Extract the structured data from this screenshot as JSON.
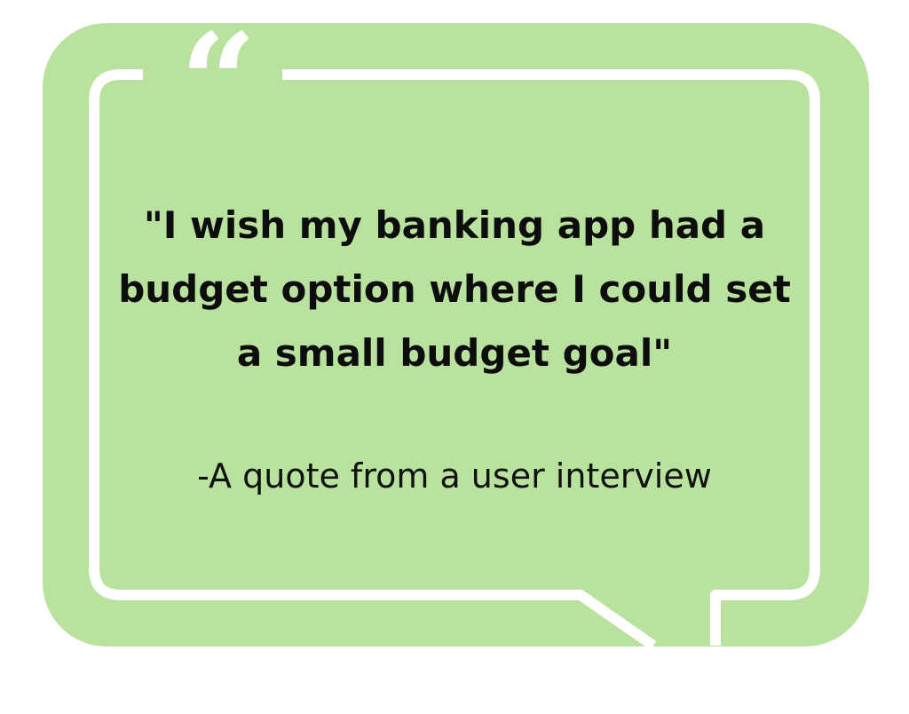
{
  "quote": {
    "open_mark": "“",
    "text": "\"I wish my banking app had a budget option where I could set a small budget goal\"",
    "attribution": "-A quote from a user interview"
  },
  "colors": {
    "background": "#ffffff",
    "bubble_fill": "#b9e29f",
    "frame_stroke": "#ffffff",
    "text": "#0d0d0d"
  },
  "icons": {
    "quote_mark": "opening-quotation-mark-icon"
  }
}
